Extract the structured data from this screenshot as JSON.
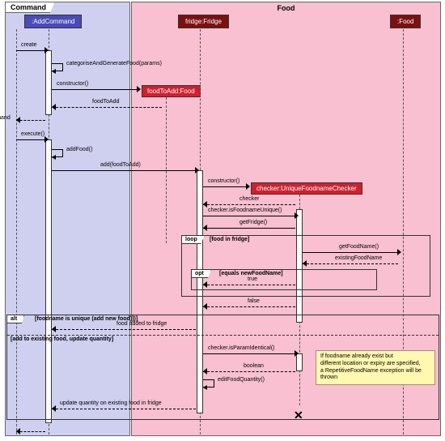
{
  "packages": {
    "cmd": "Command",
    "food": "Food"
  },
  "participants": {
    "addCommand": ":AddCommand",
    "fridge": "fridge:Fridge",
    "food": ":Food",
    "foodToAdd": "foodToAdd:Food",
    "checker": "checker:UniqueFoodnameChecker"
  },
  "messages": {
    "create": "create",
    "catGen": "categoriseAndGenerateFood(params)",
    "ctor1": "constructor()",
    "retFta": "foodToAdd",
    "retCmd": "command",
    "execute": "execute()",
    "addFood": "addFood()",
    "add": "add(foodToAdd)",
    "ctor2": "constructor()",
    "retChk": "checker",
    "isUnique": "checker.isFoodnameUnique()",
    "getFridge": "getFridge()",
    "getFoodName": "getFoodName()",
    "existingName": "existingFoodName",
    "true": "true",
    "false": "false",
    "addedToFridge": "food added to fridge",
    "isParamIdent": "checker.isParamIdentical()",
    "retBool": "boolean",
    "editQty": "editFoodQuantity()",
    "updateQty": "update quantity on existing food in fridge"
  },
  "fragments": {
    "loop": {
      "label": "loop",
      "guard": "[food in fridge]"
    },
    "opt": {
      "label": "opt",
      "guard": "[equals newFoodName]"
    },
    "alt": {
      "label": "alt",
      "guard1": "[foodname is unique (add new food)])]",
      "guard2": "[add to existing food, update quantity]"
    }
  },
  "note": {
    "l1": "If foodname already exist but",
    "l2": "different location or expiry are specified,",
    "l3": "a RepetitiveFoodName exception will be thrown"
  }
}
